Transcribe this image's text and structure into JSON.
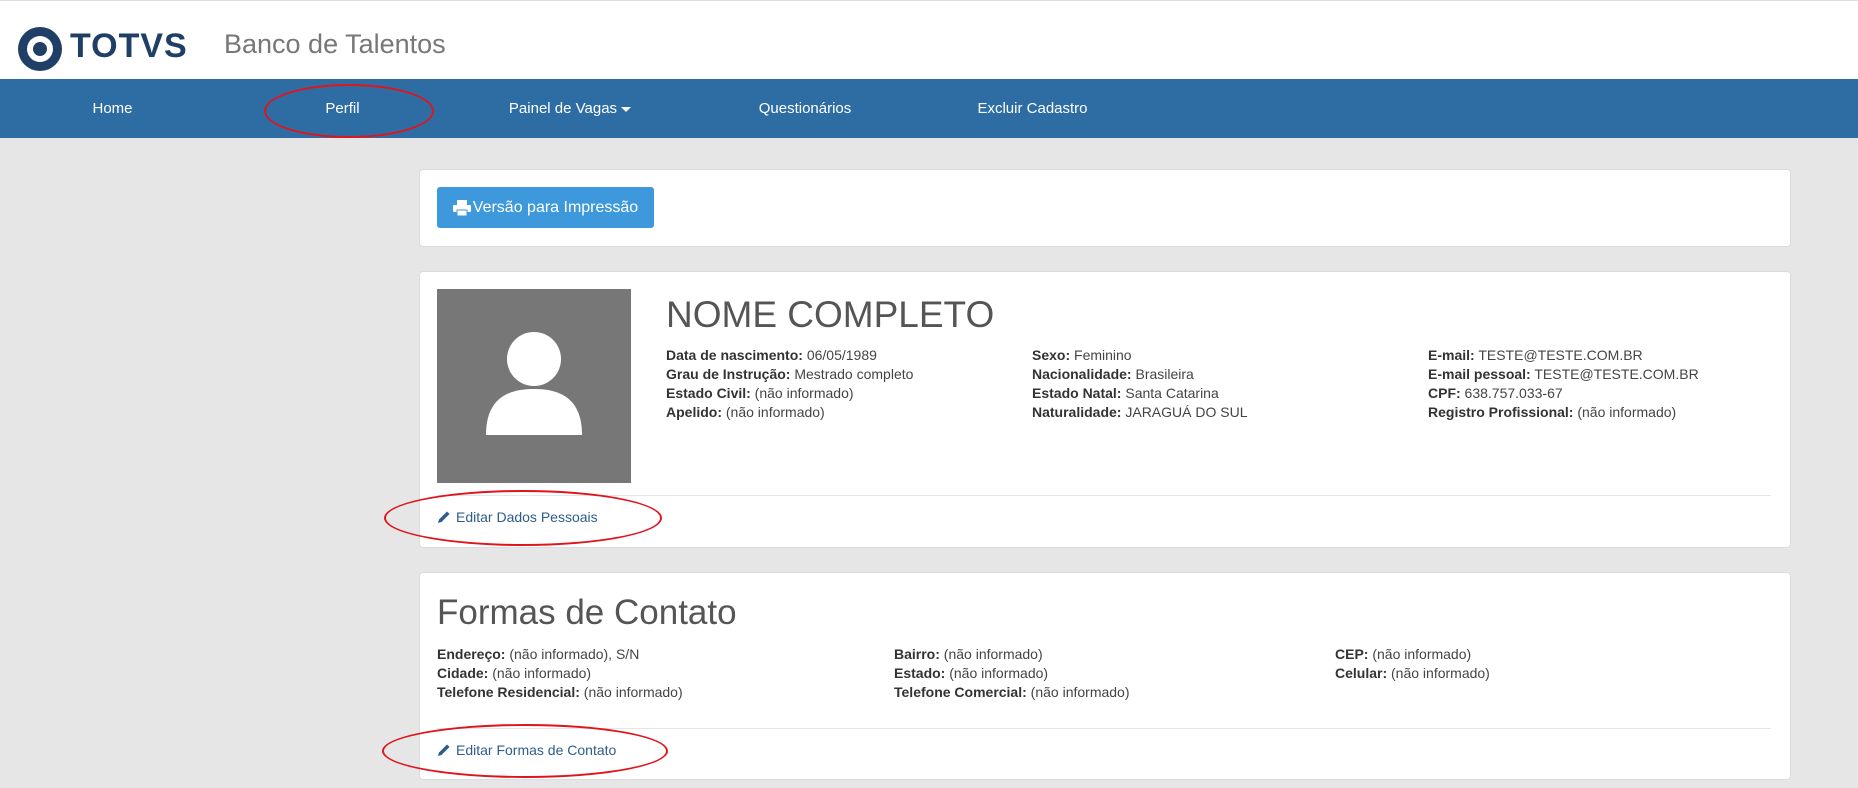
{
  "header": {
    "logo_text": "TOTVS",
    "app_title": "Banco de Talentos"
  },
  "nav": {
    "home": "Home",
    "perfil": "Perfil",
    "painel_vagas": "Painel de Vagas",
    "questionarios": "Questionários",
    "excluir_cadastro": "Excluir Cadastro"
  },
  "print_button": "Versão para Impressão",
  "profile": {
    "name": "NOME COMPLETO",
    "col1": [
      {
        "label": "Data de nascimento:",
        "value": " 06/05/1989"
      },
      {
        "label": "Grau de Instrução:",
        "value": " Mestrado completo"
      },
      {
        "label": "Estado Civil:",
        "value": " (não informado)"
      },
      {
        "label": "Apelido:",
        "value": " (não informado)"
      }
    ],
    "col2": [
      {
        "label": "Sexo:",
        "value": " Feminino"
      },
      {
        "label": "Nacionalidade:",
        "value": " Brasileira"
      },
      {
        "label": "Estado Natal:",
        "value": " Santa Catarina"
      },
      {
        "label": "Naturalidade:",
        "value": " JARAGUÁ DO SUL"
      }
    ],
    "col3": [
      {
        "label": "E-mail:",
        "value": " TESTE@TESTE.COM.BR"
      },
      {
        "label": "E-mail pessoal:",
        "value": " TESTE@TESTE.COM.BR"
      },
      {
        "label": "CPF:",
        "value": " 638.757.033-67"
      },
      {
        "label": "Registro Profissional:",
        "value": " (não informado)"
      }
    ],
    "edit_label": "Editar Dados Pessoais"
  },
  "contact": {
    "title": "Formas de Contato",
    "col1": [
      {
        "label": "Endereço:",
        "value": " (não informado), S/N"
      },
      {
        "label": "Cidade:",
        "value": " (não informado)"
      },
      {
        "label": "Telefone Residencial:",
        "value": " (não informado)"
      }
    ],
    "col2": [
      {
        "label": "Bairro:",
        "value": " (não informado)"
      },
      {
        "label": "Estado:",
        "value": " (não informado)"
      },
      {
        "label": "Telefone Comercial:",
        "value": " (não informado)"
      }
    ],
    "col3": [
      {
        "label": "CEP:",
        "value": " (não informado)"
      },
      {
        "label": "Celular:",
        "value": " (não informado)"
      }
    ],
    "edit_label": "Editar Formas de Contato"
  },
  "icons": {
    "logo": "totvs-logo-icon",
    "print": "printer-icon",
    "avatar": "user-silhouette-icon",
    "edit": "pencil-icon",
    "dropdown": "caret-down-icon"
  },
  "colors": {
    "navbar": "#2e6da4",
    "print_button": "#3d99dc",
    "annotation": "#e0151c",
    "link": "#2e5d8a"
  }
}
